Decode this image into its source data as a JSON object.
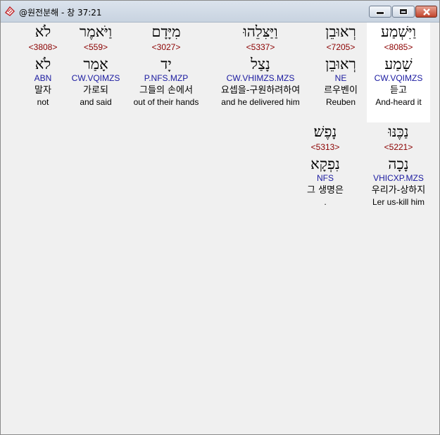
{
  "window": {
    "title": "@원전분해 - 창 37:21"
  },
  "rows": [
    {
      "words": [
        {
          "hebrew": "וַיִּשְׁמַע",
          "strong": "<8085>",
          "lemma": "שָׁמַע",
          "morph": "CW.VQIMZS",
          "korean": "듣고",
          "english": "And-heard it",
          "selected": true
        },
        {
          "hebrew": "רְאוּבֵן",
          "strong": "<7205>",
          "lemma": "רְאוּבֵן",
          "morph": "NE",
          "korean": "르우벤이",
          "english": "Reuben",
          "selected": false
        },
        {
          "hebrew": "וַיַּצִּלֵהוּ",
          "strong": "<5337>",
          "lemma": "נָצַל",
          "morph": "CW.VHIMZS.MZS",
          "korean": "요셉을-구원하려하여",
          "english": "and he delivered him",
          "selected": false
        },
        {
          "hebrew": "מִיָּדָם",
          "strong": "<3027>",
          "lemma": "יָד",
          "morph": "P.NFS.MZP",
          "korean": "그들의 손에서",
          "english": "out of their hands",
          "selected": false
        },
        {
          "hebrew": "וַיֹּאמֶר",
          "strong": "<559>",
          "lemma": "אָמַר",
          "morph": "CW.VQIMZS",
          "korean": "가로되",
          "english": "and said",
          "selected": false
        },
        {
          "hebrew": "לֹא",
          "strong": "<3808>",
          "lemma": "לֹא",
          "morph": "ABN",
          "korean": "말자",
          "english": "not",
          "selected": false
        }
      ]
    },
    {
      "words": [
        {
          "hebrew": "נַכֶּנּוּ",
          "strong": "<5221>",
          "lemma": "נָכָה",
          "morph": "VHICXP.MZS",
          "korean": "우리가-상하지",
          "english": "Ler us-kill him",
          "selected": false
        },
        {
          "hebrew": "נָפֶשׁ׃",
          "strong": "<5313>",
          "lemma": "נִפְקָא",
          "morph": "NFS",
          "korean": "그 생명은",
          "english": ".",
          "selected": false
        }
      ]
    }
  ]
}
